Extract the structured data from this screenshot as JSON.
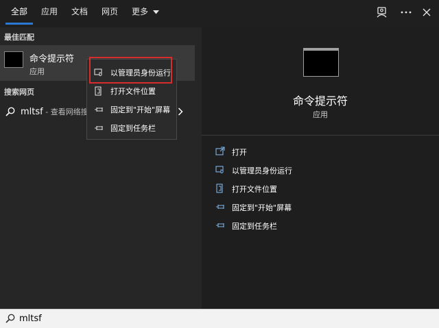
{
  "tabs": [
    {
      "label": "全部"
    },
    {
      "label": "应用"
    },
    {
      "label": "文档"
    },
    {
      "label": "网页"
    },
    {
      "label": "更多"
    }
  ],
  "sections": {
    "best_match": "最佳匹配",
    "web_search": "搜索网页"
  },
  "best_match": {
    "title": "命令提示符",
    "subtitle": "应用"
  },
  "web_result": {
    "query": "mltsf",
    "hint": " - 查看网络搜"
  },
  "context_menu": [
    {
      "label": "以管理员身份运行",
      "icon": "shield-run-icon"
    },
    {
      "label": "打开文件位置",
      "icon": "folder-location-icon"
    },
    {
      "label": "固定到\"开始\"屏幕",
      "icon": "pin-icon"
    },
    {
      "label": "固定到任务栏",
      "icon": "pin-icon"
    }
  ],
  "preview": {
    "title": "命令提示符",
    "subtitle": "应用"
  },
  "actions": [
    {
      "label": "打开",
      "icon": "open-icon"
    },
    {
      "label": "以管理员身份运行",
      "icon": "shield-run-icon"
    },
    {
      "label": "打开文件位置",
      "icon": "folder-location-icon"
    },
    {
      "label": "固定到\"开始\"屏幕",
      "icon": "pin-icon"
    },
    {
      "label": "固定到任务栏",
      "icon": "pin-icon"
    }
  ],
  "search": {
    "value": "mltsf"
  },
  "colors": {
    "accent": "#2a78d4",
    "highlight_border": "#d92c2c",
    "icon_blue": "#7fb4e6"
  }
}
